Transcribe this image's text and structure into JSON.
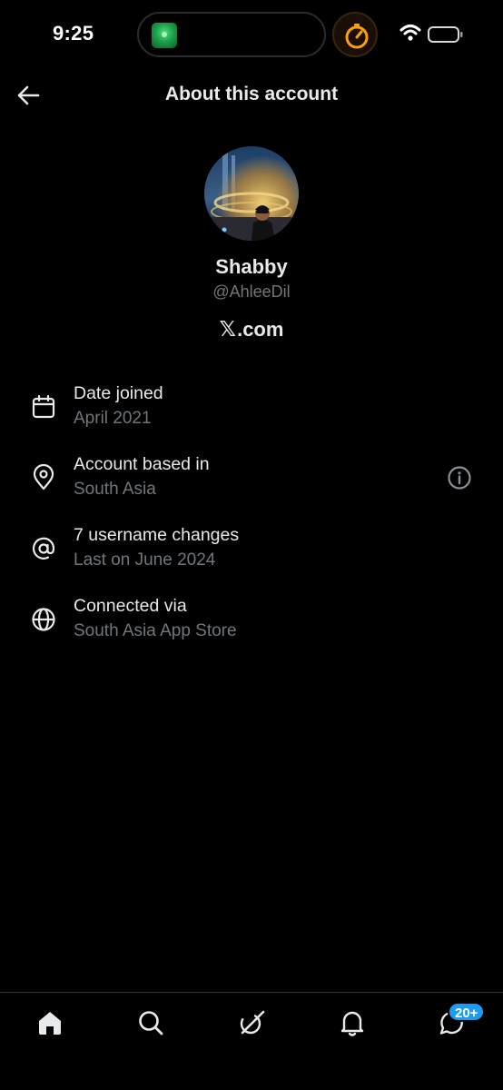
{
  "status_bar": {
    "time": "9:25",
    "live_activity_app_icon": "green-app-icon",
    "timer_icon": "stopwatch-icon",
    "accent": "#ff9f0a"
  },
  "header": {
    "back_icon": "back-arrow-icon",
    "title": "About this account"
  },
  "profile": {
    "display_name": "Shabby",
    "handle": "@AhleeDil",
    "site_logo": "𝕏",
    "site_suffix": ".com"
  },
  "info": [
    {
      "icon": "calendar-icon",
      "label": "Date joined",
      "value": "April 2021"
    },
    {
      "icon": "location-pin-icon",
      "label": "Account based in",
      "value": "South Asia",
      "action_icon": "info-circle-icon"
    },
    {
      "icon": "at-sign-icon",
      "label": "7 username changes",
      "value": "Last on June 2024"
    },
    {
      "icon": "globe-icon",
      "label": "Connected via",
      "value": "South Asia App Store"
    }
  ],
  "bottom_nav": {
    "items": [
      "home-icon",
      "search-icon",
      "grok-icon",
      "bell-icon",
      "messages-icon"
    ],
    "messages_badge": "20+",
    "badge_color": "#1d9bf0"
  }
}
